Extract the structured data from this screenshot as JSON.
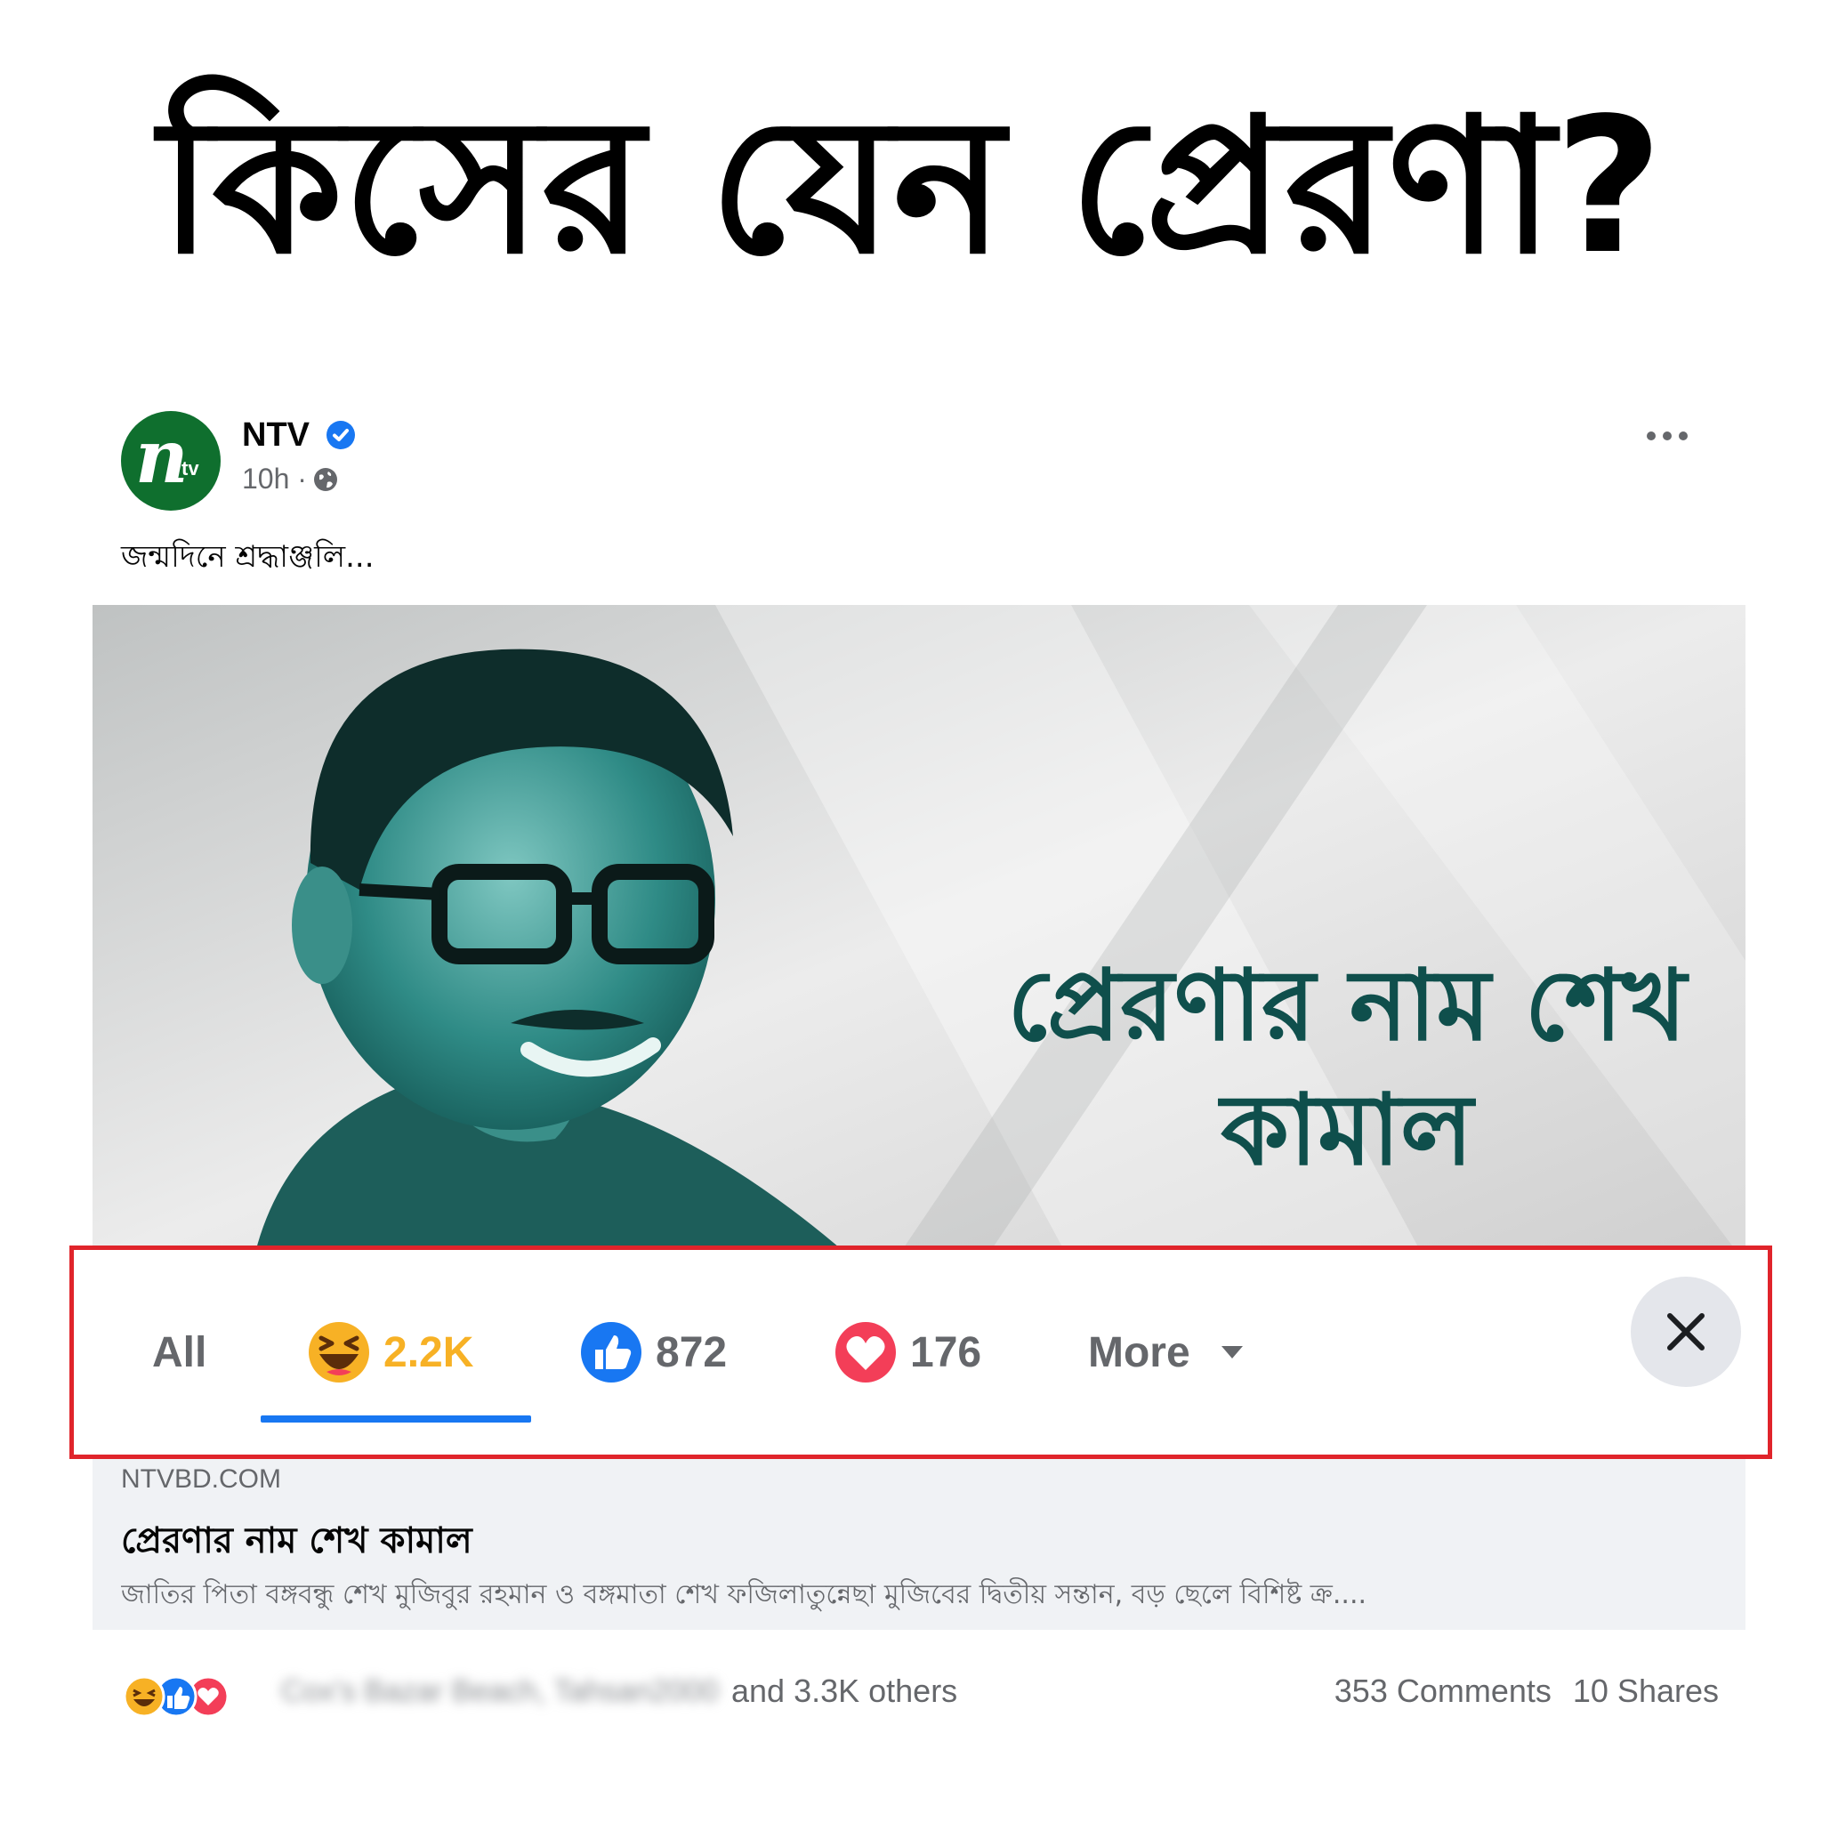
{
  "headline": "কিসের যেন প্রেরণা?",
  "post": {
    "page_name": "NTV",
    "avatar_text": {
      "main": "n",
      "sub": "tv"
    },
    "time": "10h ·",
    "caption": "জন্মদিনে শ্রদ্ধাঞ্জলি...",
    "image_title": "প্রেরণার নাম শেখ কামাল",
    "link": {
      "domain": "NTVBD.COM",
      "title": "প্রেরণার নাম শেখ কামাল",
      "description": "জাতির পিতা বঙ্গবন্ধু শেখ মুজিবুর রহমান ও বঙ্গমাতা শেখ ফজিলাতুন্নেছা মুজিবের দ্বিতীয় সন্তান, বড় ছেলে বিশিষ্ট ক্র...."
    },
    "footer": {
      "blurred_names": "Cox's Bazar Beach, Tahsan2000",
      "others": "and 3.3K others",
      "comments": "353 Comments",
      "shares": "10 Shares"
    }
  },
  "reaction_bar": {
    "tabs": [
      {
        "label": "All"
      },
      {
        "count": "2.2K",
        "icon": "haha-icon"
      },
      {
        "count": "872",
        "icon": "like-icon"
      },
      {
        "count": "176",
        "icon": "love-icon"
      },
      {
        "label": "More"
      }
    ],
    "active_tab": "haha"
  },
  "colors": {
    "accent": "#1877f2",
    "highlight_border": "#e0242b",
    "haha": "#f7b125",
    "love": "#f33e58",
    "brand_green": "#0f6f2e",
    "image_text": "#0f4f4c"
  }
}
